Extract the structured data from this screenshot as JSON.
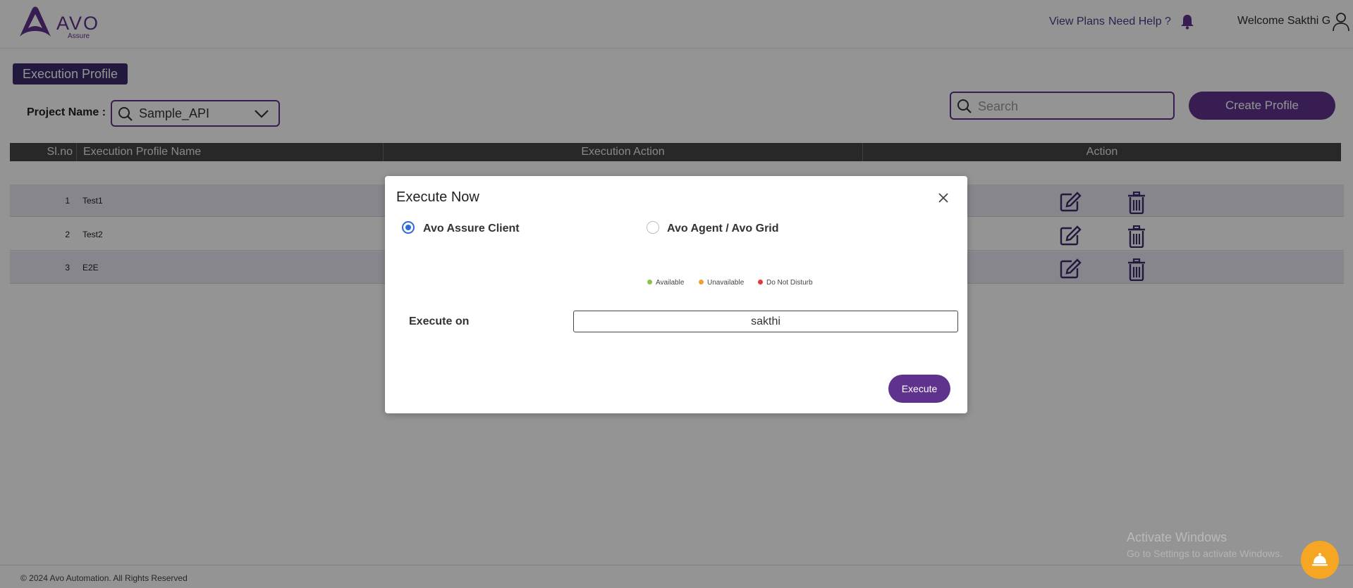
{
  "header": {
    "logo_text": "AVO",
    "logo_sub": "Assure",
    "view_plans": "View Plans",
    "need_help": "Need Help ?",
    "welcome": "Welcome Sakthi G"
  },
  "page": {
    "title": "Execution Profile",
    "project_label": "Project Name :",
    "project_value": "Sample_API",
    "search_placeholder": "Search",
    "create_button": "Create Profile"
  },
  "table": {
    "columns": [
      "Sl.no",
      "Execution Profile Name",
      "Execution Action",
      "Action"
    ],
    "rows": [
      {
        "sl": "1",
        "name": "Test1"
      },
      {
        "sl": "2",
        "name": "Test2"
      },
      {
        "sl": "3",
        "name": "E2E"
      }
    ]
  },
  "footer": "© 2024 Avo Automation. All Rights Reserved",
  "watermark": {
    "line1": "Activate Windows",
    "line2": "Go to Settings to activate Windows."
  },
  "modal": {
    "title": "Execute Now",
    "option_client": "Avo Assure Client",
    "option_agent": "Avo Agent / Avo Grid",
    "selected_option": "Avo Assure Client",
    "legend": [
      {
        "label": "Available",
        "color": "#8bc34a"
      },
      {
        "label": "Unavailable",
        "color": "#f0a030"
      },
      {
        "label": "Do Not Disturb",
        "color": "#e53935"
      }
    ],
    "execute_on_label": "Execute on",
    "execute_on_value": "sakthi",
    "execute_button": "Execute"
  },
  "colors": {
    "brand": "#5f338d",
    "page_tag": "#3d2a69",
    "table_header": "#454545",
    "fab": "#f5a623"
  }
}
